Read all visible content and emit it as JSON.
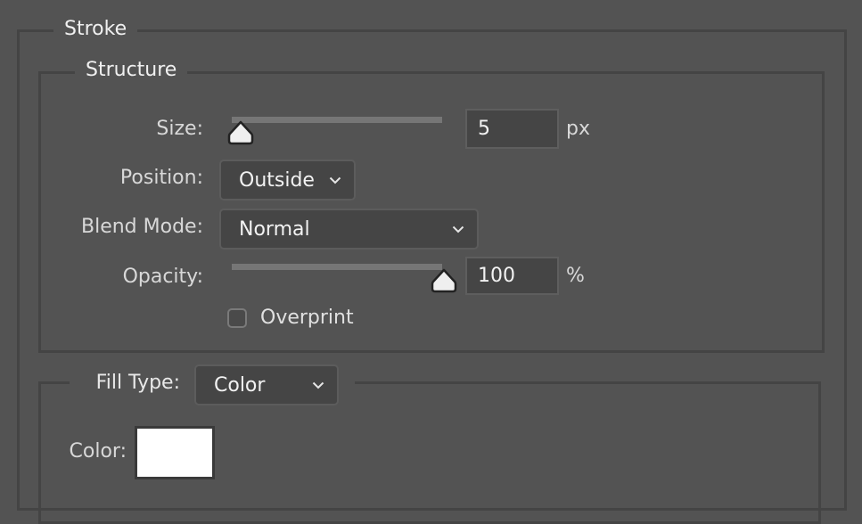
{
  "stroke_group": {
    "title": "Stroke",
    "structure": {
      "title": "Structure",
      "size": {
        "label": "Size:",
        "value": "5",
        "unit": "px",
        "slider_fraction": 0.03
      },
      "position": {
        "label": "Position:",
        "selected": "Outside"
      },
      "blend_mode": {
        "label": "Blend Mode:",
        "selected": "Normal"
      },
      "opacity": {
        "label": "Opacity:",
        "value": "100",
        "unit": "%",
        "slider_fraction": 1.0
      },
      "overprint": {
        "label": "Overprint",
        "checked": false
      }
    },
    "fill": {
      "label": "Fill Type:",
      "selected": "Color",
      "color_label": "Color:",
      "color_value": "#ffffff"
    }
  },
  "icons": {
    "dropdown": "chevron-down-icon",
    "slider_thumb": "slider-thumb-icon"
  }
}
